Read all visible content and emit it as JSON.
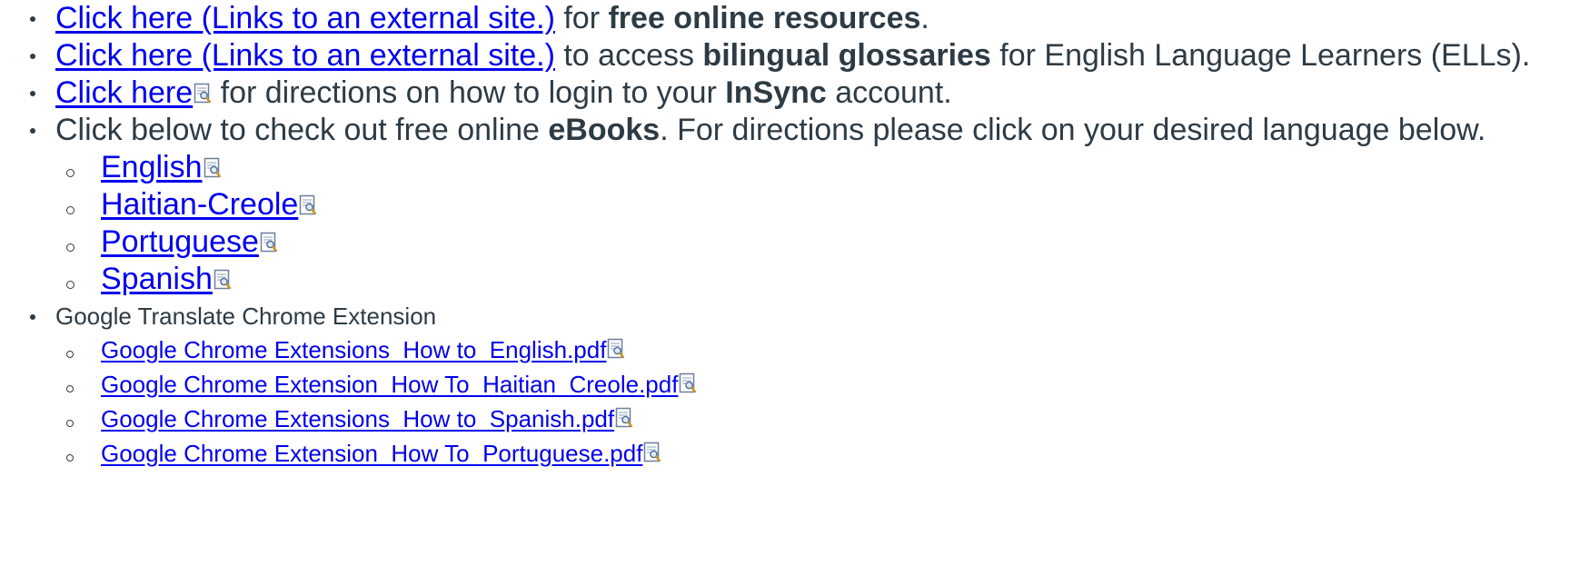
{
  "items": [
    {
      "link": "Click here (Links to an external site.)",
      "pre": " for ",
      "bold": "free online resources",
      "post": "."
    },
    {
      "link": "Click here (Links to an external site.)",
      "pre": " to access ",
      "bold": "bilingual glossaries",
      "post": " for English Language Learners (ELLs)."
    },
    {
      "link": "Click here",
      "icon": "document-preview-icon",
      "pre": " for directions on how to login to your ",
      "bold": "InSync",
      "post": " account."
    },
    {
      "pre": "Click below to check out free online ",
      "bold": "eBooks",
      "post": ".  For directions please click on your desired language below.",
      "subitems": [
        {
          "link": "English",
          "icon": "document-preview-icon"
        },
        {
          "link": "Haitian-Creole",
          "icon": "document-preview-icon"
        },
        {
          "link": "Portuguese",
          "icon": "document-preview-icon"
        },
        {
          "link": "Spanish",
          "icon": "document-preview-icon"
        }
      ]
    },
    {
      "text": "Google Translate Chrome Extension",
      "subitems": [
        {
          "link": "Google Chrome Extensions_How to_English.pdf",
          "icon": "document-preview-icon"
        },
        {
          "link": "Google Chrome Extension_How To_Haitian_Creole.pdf",
          "icon": "document-preview-icon"
        },
        {
          "link": "Google Chrome Extensions_How to_Spanish.pdf",
          "icon": "document-preview-icon"
        },
        {
          "link": "Google Chrome Extension_How To_Portuguese.pdf",
          "icon": "document-preview-icon"
        }
      ]
    }
  ],
  "colors": {
    "link": "#0000ee",
    "text": "#2d3b45"
  }
}
